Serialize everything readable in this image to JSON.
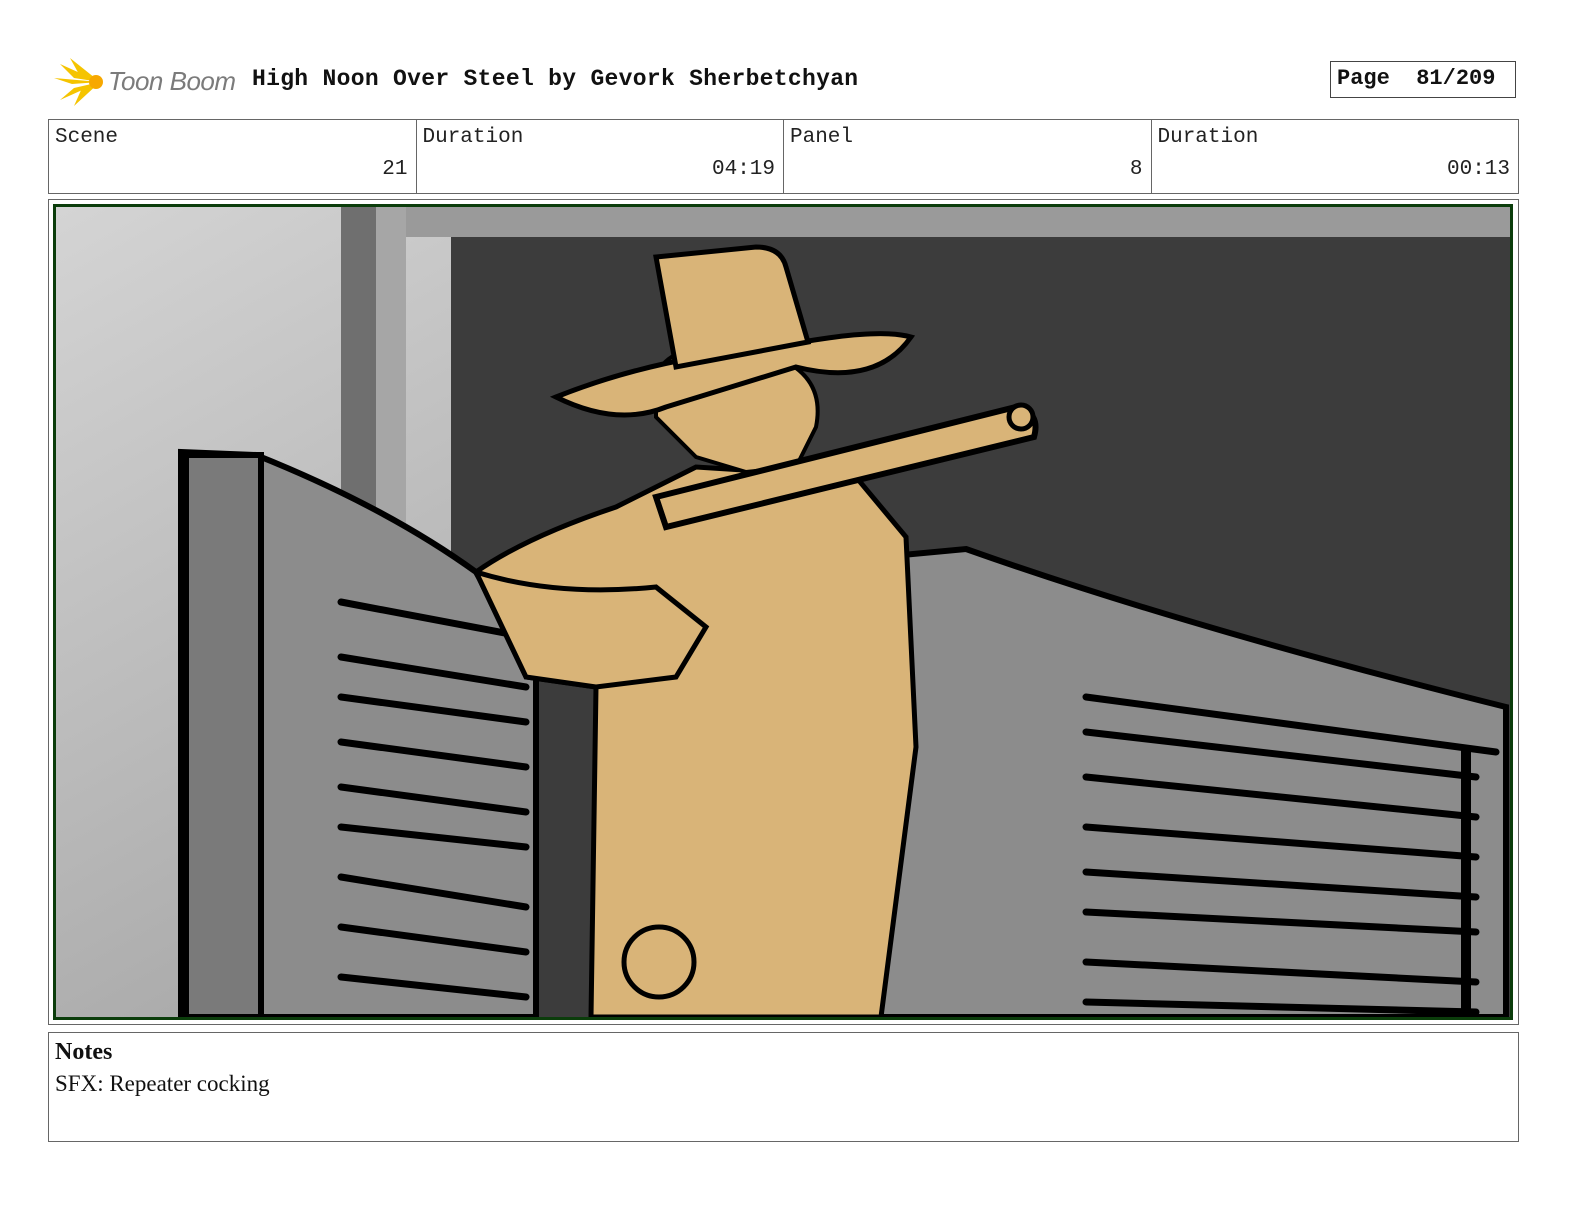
{
  "header": {
    "logo_text": "Toon Boom",
    "title": "High Noon Over Steel by Gevork Sherbetchyan",
    "page_label": "Page",
    "page_value": "81/209"
  },
  "info": {
    "scene_label": "Scene",
    "scene_value": "21",
    "scene_duration_label": "Duration",
    "scene_duration_value": "04:19",
    "panel_label": "Panel",
    "panel_value": "8",
    "panel_duration_label": "Duration",
    "panel_duration_value": "00:13"
  },
  "colors": {
    "skin": "#d9b478",
    "frame_border": "#0b3d0b",
    "backdrop": "#3c3c3c"
  },
  "notes": {
    "title": "Notes",
    "text": "SFX: Repeater cocking"
  }
}
